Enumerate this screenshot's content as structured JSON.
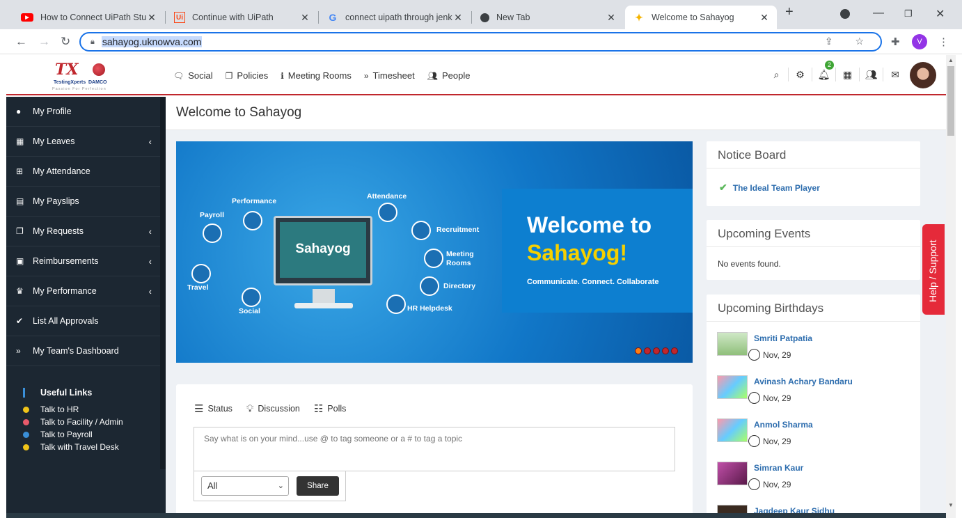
{
  "browser": {
    "tabs": [
      {
        "title": "How to Connect UiPath Studi",
        "icon": "youtube-icon",
        "color": "#ff0000"
      },
      {
        "title": "Continue with UiPath",
        "icon": "uipath-icon",
        "color": "#fa4616"
      },
      {
        "title": "connect uipath through jenki",
        "icon": "google-icon",
        "color": "#4285f4"
      },
      {
        "title": "New Tab",
        "icon": "chrome-icon",
        "color": "#3c4043"
      },
      {
        "title": "Welcome to Sahayog",
        "icon": "pinwheel-icon",
        "color": "#f5b400"
      }
    ],
    "url": "sahayog.uknowva.com",
    "profile_initial": "V"
  },
  "header": {
    "logo": {
      "mark": "TX",
      "name": "TestingXperts",
      "partner": "DAMCO",
      "tagline": "Passion For Perfection"
    },
    "nav": [
      {
        "label": "Social",
        "icon": "chat-icon"
      },
      {
        "label": "Policies",
        "icon": "copy-icon"
      },
      {
        "label": "Meeting Rooms",
        "icon": "info-icon"
      },
      {
        "label": "Timesheet",
        "icon": "double-chevron-icon"
      },
      {
        "label": "People",
        "icon": "users-icon"
      }
    ],
    "notification_count": "2"
  },
  "sidebar": {
    "items": [
      {
        "label": "My Profile",
        "icon": "user-icon",
        "expandable": false
      },
      {
        "label": "My Leaves",
        "icon": "calendar-icon",
        "expandable": true
      },
      {
        "label": "My Attendance",
        "icon": "calendar-plus-icon",
        "expandable": false
      },
      {
        "label": "My Payslips",
        "icon": "file-icon",
        "expandable": false
      },
      {
        "label": "My Requests",
        "icon": "copy-icon",
        "expandable": true
      },
      {
        "label": "Reimbursements",
        "icon": "money-icon",
        "expandable": true
      },
      {
        "label": "My Performance",
        "icon": "trophy-icon",
        "expandable": true
      },
      {
        "label": "List All Approvals",
        "icon": "check-icon",
        "expandable": false
      },
      {
        "label": "My Team's Dashboard",
        "icon": "double-chevron-icon",
        "expandable": false
      }
    ],
    "useful_links_title": "Useful Links",
    "useful_links": [
      {
        "label": "Talk to HR",
        "color": "#f0c419"
      },
      {
        "label": "Talk to Facility / Admin",
        "color": "#e85a6b"
      },
      {
        "label": "Talk to Payroll",
        "color": "#3a8fd8"
      },
      {
        "label": "Talk with Travel Desk",
        "color": "#f0c419"
      }
    ]
  },
  "main": {
    "page_title": "Welcome to Sahayog",
    "banner": {
      "welcome_line1": "Welcome to",
      "welcome_line2": "Sahayog!",
      "tagline": "Communicate. Connect. Collaborate",
      "center_label": "Sahayog",
      "nodes": [
        "Performance",
        "Payroll",
        "Attendance",
        "Recruitment",
        "Meeting",
        "Rooms",
        "Directory",
        "HR Helpdesk",
        "Travel",
        "Social"
      ],
      "slide_count": 5,
      "active_slide": 1
    },
    "status": {
      "tabs": [
        {
          "label": "Status",
          "icon": "menu-icon"
        },
        {
          "label": "Discussion",
          "icon": "bulb-icon"
        },
        {
          "label": "Polls",
          "icon": "poll-icon"
        }
      ],
      "placeholder": "Say what is on your mind...use @ to tag someone or a # to tag a topic",
      "audience": "All",
      "share_label": "Share"
    }
  },
  "right": {
    "notice_board": {
      "title": "Notice Board",
      "items": [
        "The Ideal Team Player"
      ]
    },
    "events": {
      "title": "Upcoming Events",
      "empty": "No events found."
    },
    "birthdays": {
      "title": "Upcoming Birthdays",
      "people": [
        {
          "name": "Smriti Patpatia",
          "date": "Nov, 29"
        },
        {
          "name": "Avinash Achary Bandaru",
          "date": "Nov, 29"
        },
        {
          "name": "Anmol Sharma",
          "date": "Nov, 29"
        },
        {
          "name": "Simran Kaur",
          "date": "Nov, 29"
        },
        {
          "name": "Jagdeep Kaur Sidhu",
          "date": ""
        }
      ]
    },
    "help_tab": "Help / Support"
  }
}
